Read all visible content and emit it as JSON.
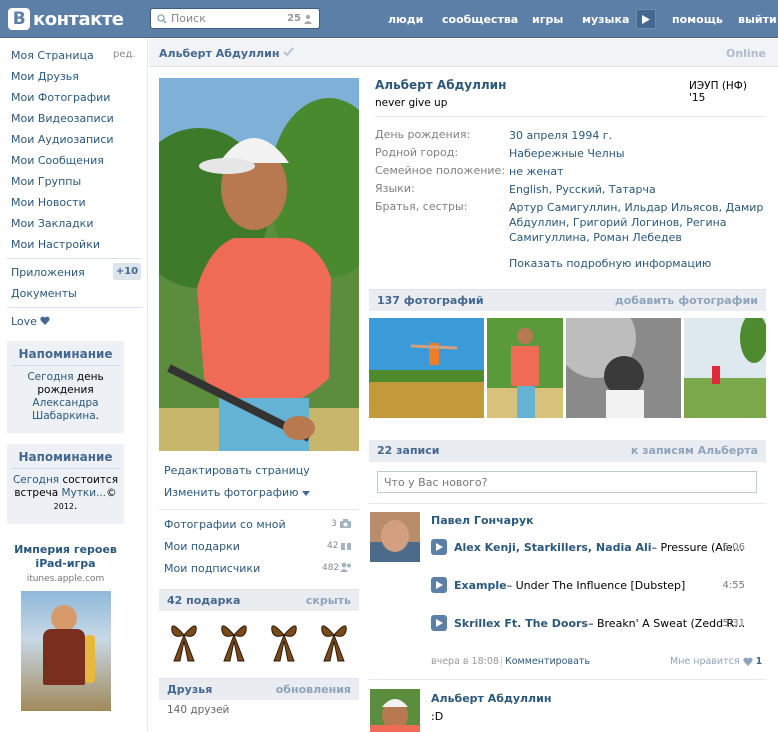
{
  "header": {
    "logo_text": "контакте",
    "logo_letter": "В",
    "search_placeholder": "Поиск",
    "search_count": "25",
    "nav": [
      "люди",
      "сообщества",
      "игры",
      "музыка",
      "помощь",
      "выйти"
    ]
  },
  "sidebar": {
    "items": [
      "Моя Страница",
      "Мои Друзья",
      "Мои Фотографии",
      "Мои Видеозаписи",
      "Мои Аудиозаписи",
      "Мои Сообщения",
      "Мои Группы",
      "Мои Новости",
      "Мои Закладки",
      "Мои Настройки"
    ],
    "edit": "ред.",
    "apps": "Приложения",
    "apps_badge": "+10",
    "docs": "Документы",
    "love": "Love",
    "reminder1": {
      "title": "Напоминание",
      "today": "Сегодня",
      "text": "день рождения",
      "name": "Александра Шабаркина",
      "dot": "."
    },
    "reminder2": {
      "title": "Напоминание",
      "today": "Сегодня",
      "text": "состоится встреча",
      "link": "Мутки...",
      "mark": "©",
      "year": "2012",
      "dot": "."
    },
    "ad": {
      "title": "Империя героев iPad-игра",
      "url": "itunes.apple.com"
    }
  },
  "profile": {
    "name": "Альберт Абдуллин",
    "online": "Online",
    "full_name": "Альберт Абдуллин",
    "status": "never give up",
    "university": "ИЭУП (НФ) '15",
    "fields": [
      {
        "key": "День рождения:",
        "value": "30 апреля 1994 г."
      },
      {
        "key": "Родной город:",
        "value": "Набережные Челны"
      },
      {
        "key": "Семейное положение:",
        "value": "не женат"
      },
      {
        "key": "Языки:",
        "value": "English, Русский, Татарча"
      },
      {
        "key": "Братья, сестры:",
        "value": "Артур Самигуллин, Ильдар Ильясов, Дамир Абдуллин, Григорий Логинов, Регина Самигуллина, Роман Лебедев"
      }
    ],
    "more_info": "Показать подробную информацию",
    "edit_page": "Редактировать страницу",
    "change_photo": "Изменить фотографию",
    "links": [
      {
        "label": "Фотографии со мной",
        "count": "3"
      },
      {
        "label": "Мои подарки",
        "count": "42"
      },
      {
        "label": "Мои подписчики",
        "count": "482"
      }
    ],
    "gifts": {
      "title": "42 подарка",
      "action": "скрыть"
    },
    "friends": {
      "title": "Друзья",
      "action": "обновления",
      "count": "140 друзей"
    }
  },
  "photos": {
    "title": "137 фотографий",
    "action": "добавить фотографии"
  },
  "wall": {
    "title": "22 записи",
    "action": "к записям Альберта",
    "placeholder": "Что у Вас нового?",
    "post1": {
      "author": "Павел Гончарук",
      "tracks": [
        {
          "artist": "Alex Kenji, Starkillers, Nadia Ali",
          "title": " – Pressure (Ale…",
          "dur": "6:06"
        },
        {
          "artist": "Example",
          "title": " – Under The Influence [Dubstep]",
          "dur": "4:55"
        },
        {
          "artist": "Skrillex Ft. The Doors",
          "title": " – Breakn' A Sweat (Zedd R…",
          "dur": "5:31"
        }
      ],
      "time": "вчера в 18:08",
      "comment": "Комментировать",
      "like": "Мне нравится",
      "likes": "1"
    },
    "post2": {
      "author": "Альберт Абдуллин",
      "text": ":D"
    }
  }
}
